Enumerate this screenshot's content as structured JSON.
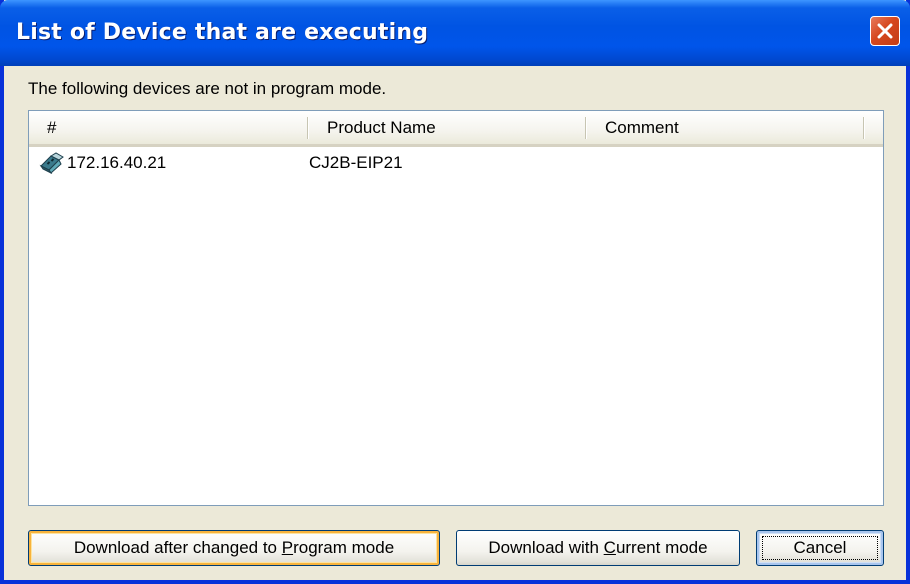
{
  "window": {
    "title": "List of Device that are executing"
  },
  "message": "The following devices are not in program mode.",
  "list": {
    "columns": [
      "#",
      "Product Name",
      "Comment"
    ],
    "rows": [
      {
        "id": "172.16.40.21",
        "product_name": "CJ2B-EIP21",
        "comment": "",
        "icon": "plc-device-icon"
      }
    ]
  },
  "buttons": {
    "program_mode": {
      "before": "Download after changed to ",
      "mnemonic": "P",
      "after": "rogram mode"
    },
    "current_mode": {
      "before": "Download with ",
      "mnemonic": "C",
      "after": "urrent mode"
    },
    "cancel": "Cancel"
  },
  "colors": {
    "titlebar": "#0054e3",
    "close_button": "#d6481f",
    "face": "#ece9d8",
    "hot_highlight": "#f8b33c"
  }
}
